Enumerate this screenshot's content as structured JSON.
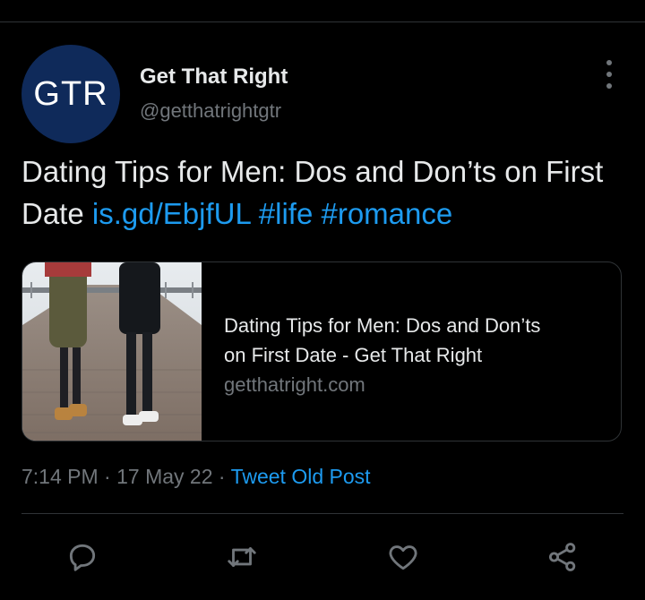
{
  "profile": {
    "avatar_text": "GTR",
    "display_name": "Get That Right",
    "handle": "@getthatrightgtr"
  },
  "tweet": {
    "text": "Dating Tips for Men: Dos and Don’ts on First Date",
    "link": "is.gd/EbjfUL",
    "hashtags": [
      "#life",
      "#romance"
    ]
  },
  "card": {
    "title_line1": "Dating Tips for Men: Dos and Don’ts",
    "title_line2": "on First Date - Get That Right",
    "domain": "getthatright.com"
  },
  "meta": {
    "time": "7:14 PM",
    "date": "17 May 22",
    "source": "Tweet Old Post"
  },
  "actions": {
    "reply_icon": "reply-icon",
    "retweet_icon": "retweet-icon",
    "like_icon": "heart-icon",
    "share_icon": "share-icon"
  },
  "colors": {
    "background": "#000000",
    "text": "#e7e9ea",
    "muted": "#71767b",
    "link": "#1d9bf0",
    "avatar": "#0f2a5a"
  }
}
